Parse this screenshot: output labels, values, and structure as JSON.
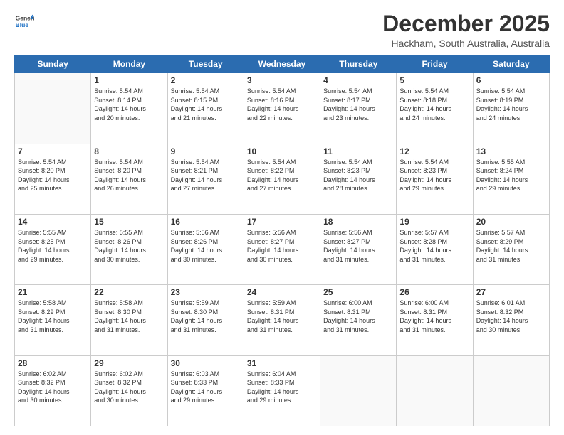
{
  "logo": {
    "line1": "General",
    "line2": "Blue"
  },
  "title": "December 2025",
  "subtitle": "Hackham, South Australia, Australia",
  "days_of_week": [
    "Sunday",
    "Monday",
    "Tuesday",
    "Wednesday",
    "Thursday",
    "Friday",
    "Saturday"
  ],
  "weeks": [
    [
      {
        "day": "",
        "info": ""
      },
      {
        "day": "1",
        "info": "Sunrise: 5:54 AM\nSunset: 8:14 PM\nDaylight: 14 hours\nand 20 minutes."
      },
      {
        "day": "2",
        "info": "Sunrise: 5:54 AM\nSunset: 8:15 PM\nDaylight: 14 hours\nand 21 minutes."
      },
      {
        "day": "3",
        "info": "Sunrise: 5:54 AM\nSunset: 8:16 PM\nDaylight: 14 hours\nand 22 minutes."
      },
      {
        "day": "4",
        "info": "Sunrise: 5:54 AM\nSunset: 8:17 PM\nDaylight: 14 hours\nand 23 minutes."
      },
      {
        "day": "5",
        "info": "Sunrise: 5:54 AM\nSunset: 8:18 PM\nDaylight: 14 hours\nand 24 minutes."
      },
      {
        "day": "6",
        "info": "Sunrise: 5:54 AM\nSunset: 8:19 PM\nDaylight: 14 hours\nand 24 minutes."
      }
    ],
    [
      {
        "day": "7",
        "info": "Sunrise: 5:54 AM\nSunset: 8:20 PM\nDaylight: 14 hours\nand 25 minutes."
      },
      {
        "day": "8",
        "info": "Sunrise: 5:54 AM\nSunset: 8:20 PM\nDaylight: 14 hours\nand 26 minutes."
      },
      {
        "day": "9",
        "info": "Sunrise: 5:54 AM\nSunset: 8:21 PM\nDaylight: 14 hours\nand 27 minutes."
      },
      {
        "day": "10",
        "info": "Sunrise: 5:54 AM\nSunset: 8:22 PM\nDaylight: 14 hours\nand 27 minutes."
      },
      {
        "day": "11",
        "info": "Sunrise: 5:54 AM\nSunset: 8:23 PM\nDaylight: 14 hours\nand 28 minutes."
      },
      {
        "day": "12",
        "info": "Sunrise: 5:54 AM\nSunset: 8:23 PM\nDaylight: 14 hours\nand 29 minutes."
      },
      {
        "day": "13",
        "info": "Sunrise: 5:55 AM\nSunset: 8:24 PM\nDaylight: 14 hours\nand 29 minutes."
      }
    ],
    [
      {
        "day": "14",
        "info": "Sunrise: 5:55 AM\nSunset: 8:25 PM\nDaylight: 14 hours\nand 29 minutes."
      },
      {
        "day": "15",
        "info": "Sunrise: 5:55 AM\nSunset: 8:26 PM\nDaylight: 14 hours\nand 30 minutes."
      },
      {
        "day": "16",
        "info": "Sunrise: 5:56 AM\nSunset: 8:26 PM\nDaylight: 14 hours\nand 30 minutes."
      },
      {
        "day": "17",
        "info": "Sunrise: 5:56 AM\nSunset: 8:27 PM\nDaylight: 14 hours\nand 30 minutes."
      },
      {
        "day": "18",
        "info": "Sunrise: 5:56 AM\nSunset: 8:27 PM\nDaylight: 14 hours\nand 31 minutes."
      },
      {
        "day": "19",
        "info": "Sunrise: 5:57 AM\nSunset: 8:28 PM\nDaylight: 14 hours\nand 31 minutes."
      },
      {
        "day": "20",
        "info": "Sunrise: 5:57 AM\nSunset: 8:29 PM\nDaylight: 14 hours\nand 31 minutes."
      }
    ],
    [
      {
        "day": "21",
        "info": "Sunrise: 5:58 AM\nSunset: 8:29 PM\nDaylight: 14 hours\nand 31 minutes."
      },
      {
        "day": "22",
        "info": "Sunrise: 5:58 AM\nSunset: 8:30 PM\nDaylight: 14 hours\nand 31 minutes."
      },
      {
        "day": "23",
        "info": "Sunrise: 5:59 AM\nSunset: 8:30 PM\nDaylight: 14 hours\nand 31 minutes."
      },
      {
        "day": "24",
        "info": "Sunrise: 5:59 AM\nSunset: 8:31 PM\nDaylight: 14 hours\nand 31 minutes."
      },
      {
        "day": "25",
        "info": "Sunrise: 6:00 AM\nSunset: 8:31 PM\nDaylight: 14 hours\nand 31 minutes."
      },
      {
        "day": "26",
        "info": "Sunrise: 6:00 AM\nSunset: 8:31 PM\nDaylight: 14 hours\nand 31 minutes."
      },
      {
        "day": "27",
        "info": "Sunrise: 6:01 AM\nSunset: 8:32 PM\nDaylight: 14 hours\nand 30 minutes."
      }
    ],
    [
      {
        "day": "28",
        "info": "Sunrise: 6:02 AM\nSunset: 8:32 PM\nDaylight: 14 hours\nand 30 minutes."
      },
      {
        "day": "29",
        "info": "Sunrise: 6:02 AM\nSunset: 8:32 PM\nDaylight: 14 hours\nand 30 minutes."
      },
      {
        "day": "30",
        "info": "Sunrise: 6:03 AM\nSunset: 8:33 PM\nDaylight: 14 hours\nand 29 minutes."
      },
      {
        "day": "31",
        "info": "Sunrise: 6:04 AM\nSunset: 8:33 PM\nDaylight: 14 hours\nand 29 minutes."
      },
      {
        "day": "",
        "info": ""
      },
      {
        "day": "",
        "info": ""
      },
      {
        "day": "",
        "info": ""
      }
    ]
  ]
}
